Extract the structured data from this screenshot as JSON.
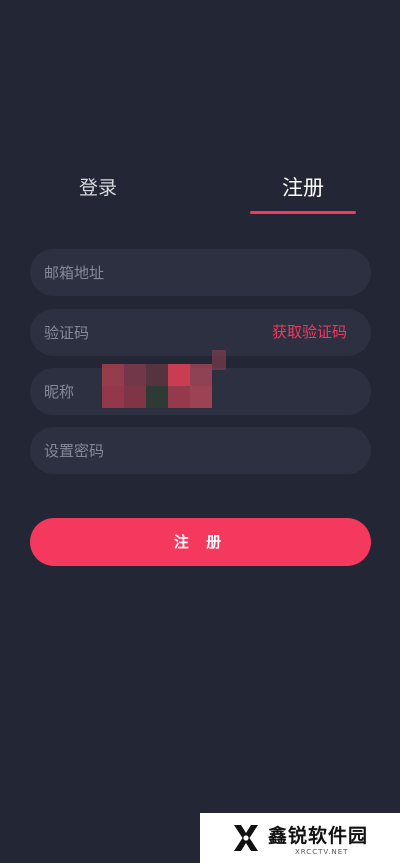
{
  "colors": {
    "background": "#232634",
    "field_background": "#2c3040",
    "accent": "#f5385e",
    "placeholder": "#868a98"
  },
  "tabs": {
    "login_label": "登录",
    "register_label": "注册",
    "active": "register"
  },
  "form": {
    "email_placeholder": "邮箱地址",
    "code_placeholder": "验证码",
    "get_code_label": "获取验证码",
    "nickname_placeholder": "昵称",
    "password_placeholder": "设置密码"
  },
  "submit": {
    "label": "注 册"
  },
  "watermark": {
    "name": "鑫锐软件园",
    "url": "XRCCTV.NET",
    "logo_icon": "x-logo-icon"
  }
}
